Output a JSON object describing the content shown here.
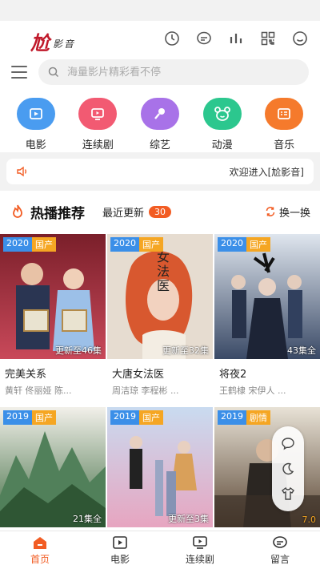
{
  "header": {
    "logo_big": "尬",
    "logo_small": "影音",
    "icons": [
      "clock-icon",
      "message-icon",
      "chart-icon",
      "qr-icon",
      "smile-icon"
    ]
  },
  "search": {
    "placeholder": "海量影片精彩看不停"
  },
  "categories": [
    {
      "label": "电影",
      "color": "#4a9cf0",
      "icon": "film-icon"
    },
    {
      "label": "连续剧",
      "color": "#f25a72",
      "icon": "tv-icon"
    },
    {
      "label": "综艺",
      "color": "#a872e8",
      "icon": "mic-icon"
    },
    {
      "label": "动漫",
      "color": "#2cc78e",
      "icon": "bear-icon"
    },
    {
      "label": "音乐",
      "color": "#f57a2c",
      "icon": "music-icon"
    }
  ],
  "notice": {
    "text": "欢迎进入[尬影音]",
    "icon": "speaker-icon"
  },
  "section": {
    "title": "热播推荐",
    "recent_label": "最近更新",
    "recent_count": "30",
    "swap_label": "换一换"
  },
  "row1": [
    {
      "year": "2020",
      "genre": "国产",
      "episodes": "更新至46集",
      "name": "完美关系",
      "cast": "黄轩 佟丽娅 陈..."
    },
    {
      "year": "2020",
      "genre": "国产",
      "episodes": "更新至32集",
      "name": "大唐女法医",
      "cast": "周洁琼 李程彬 ..."
    },
    {
      "year": "2020",
      "genre": "国产",
      "episodes": "43集全",
      "name": "将夜2",
      "cast": "王鹤棣 宋伊人 ..."
    }
  ],
  "row2": [
    {
      "year": "2019",
      "genre": "国产",
      "episodes": "21集全"
    },
    {
      "year": "2019",
      "genre": "国产",
      "episodes": "更新至3集"
    },
    {
      "year": "2019",
      "genre": "剧情",
      "episodes": "7.0"
    }
  ],
  "tabs": [
    {
      "label": "首页",
      "active": true
    },
    {
      "label": "电影",
      "active": false
    },
    {
      "label": "连续剧",
      "active": false
    },
    {
      "label": "留言",
      "active": false
    }
  ],
  "colors": {
    "accent": "#f25c23",
    "year_tag": "#3b8fe8",
    "genre_tag": "#f5a623"
  }
}
